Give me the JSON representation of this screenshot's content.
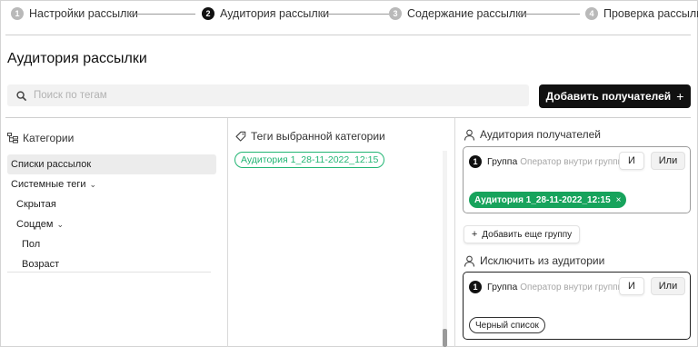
{
  "stepper": {
    "steps": [
      {
        "num": "1",
        "label": "Настройки рассылки"
      },
      {
        "num": "2",
        "label": "Аудитория рассылки"
      },
      {
        "num": "3",
        "label": "Содержание рассылки"
      },
      {
        "num": "4",
        "label": "Проверка рассылки"
      }
    ],
    "active_step": 2
  },
  "page": {
    "title": "Аудитория рассылки"
  },
  "search": {
    "placeholder": "Поиск по тегам",
    "value": ""
  },
  "toolbar": {
    "add_recipients_label": "Добавить получателей",
    "add_recipients_icon": "+"
  },
  "categories": {
    "header": "Категории",
    "items": [
      {
        "label": "Списки рассылок",
        "selected": true
      },
      {
        "label": "Системные теги",
        "chevron": "⌄"
      },
      {
        "label": "Скрытая"
      },
      {
        "label": "Соцдем",
        "chevron": "⌄"
      },
      {
        "label": "Пол"
      },
      {
        "label": "Возраст"
      }
    ]
  },
  "tags_panel": {
    "header": "Теги выбранной категории",
    "tags": [
      "Аудитория 1_28-11-2022_12:15"
    ]
  },
  "audience": {
    "header": "Аудитория получателей",
    "group": {
      "num": "1",
      "title": "Группа",
      "subtitle": "Оператор внутри группы",
      "and_label": "И",
      "or_label": "Или",
      "chips": [
        {
          "label": "Аудитория 1_28-11-2022_12:15",
          "remove": "×"
        }
      ]
    },
    "add_group_label": "Добавить еще группу",
    "add_group_icon": "+"
  },
  "exclude": {
    "header": "Исключить из аудитории",
    "group": {
      "num": "1",
      "title": "Группа",
      "subtitle": "Оператор внутри группы",
      "and_label": "И",
      "or_label": "Или",
      "chips": [
        {
          "label": "Черный список"
        }
      ]
    }
  },
  "colors": {
    "accent_dark": "#111111",
    "tag_green": "#17a35c",
    "tag_outline_green": "#22b573"
  }
}
